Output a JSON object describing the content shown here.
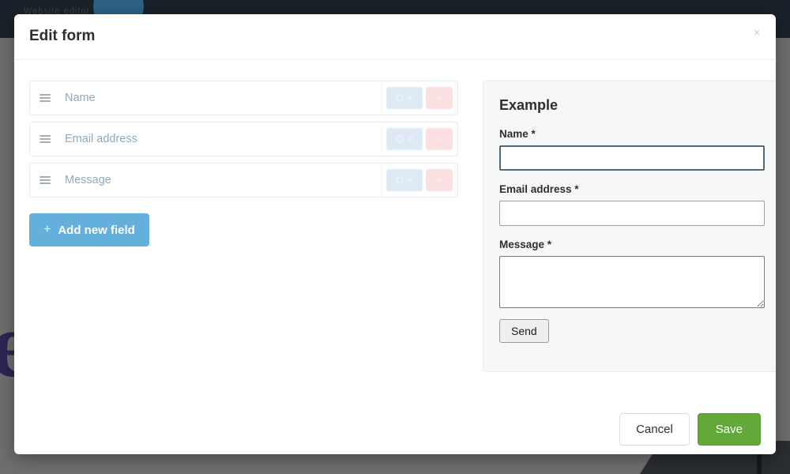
{
  "background": {
    "navbar_text": "Website editor",
    "letter": "e"
  },
  "modal": {
    "title": "Edit form",
    "close_label": "×"
  },
  "field_editor": {
    "fields": [
      {
        "label": "Name",
        "drag_handle": "drag-handle-icon",
        "settings_icon": "gear-icon",
        "caret_icon": "chevron-down-icon",
        "delete_label": "×"
      },
      {
        "label": "Email address",
        "drag_handle": "drag-handle-icon",
        "settings_icon": "gear-icon",
        "caret_icon": "chevron-down-icon",
        "delete_label": "×"
      },
      {
        "label": "Message",
        "drag_handle": "drag-handle-icon",
        "settings_icon": "gear-icon",
        "caret_icon": "chevron-down-icon",
        "delete_label": "×"
      }
    ],
    "add_new_field": {
      "plus": "+",
      "label": "Add new field"
    }
  },
  "example_panel": {
    "title": "Example",
    "fields": [
      {
        "label": "Name *",
        "value": "",
        "type": "text",
        "focused": true
      },
      {
        "label": "Email address *",
        "value": "",
        "type": "text",
        "focused": false
      },
      {
        "label": "Message *",
        "value": "",
        "type": "textarea",
        "focused": false
      }
    ],
    "submit_label": "Send"
  },
  "footer": {
    "cancel_label": "Cancel",
    "save_label": "Save"
  },
  "colors": {
    "accent_blue": "#64b0dd",
    "save_green": "#63a83a",
    "field_label_blue": "#8fa9bd",
    "settings_btn": "#dde9f5",
    "delete_btn": "#fadfe0",
    "panel_bg": "#f7f7f5"
  }
}
